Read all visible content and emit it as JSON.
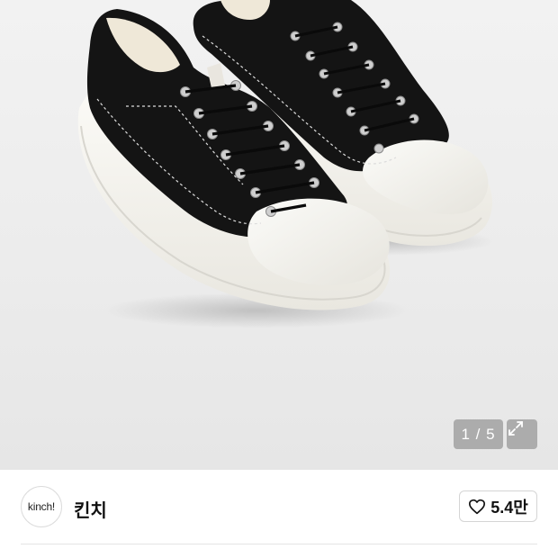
{
  "gallery": {
    "image_alt": "black canvas low-top sneakers with white platform sole",
    "counter": "1 / 5",
    "expand_icon": "expand-icon"
  },
  "seller": {
    "avatar_text": "kinch!",
    "name": "킨치"
  },
  "like": {
    "icon": "heart-icon",
    "count": "5.4만"
  },
  "colors": {
    "overlay": "#969696",
    "shoe_upper": "#141414",
    "sole": "#f4f2ec"
  }
}
